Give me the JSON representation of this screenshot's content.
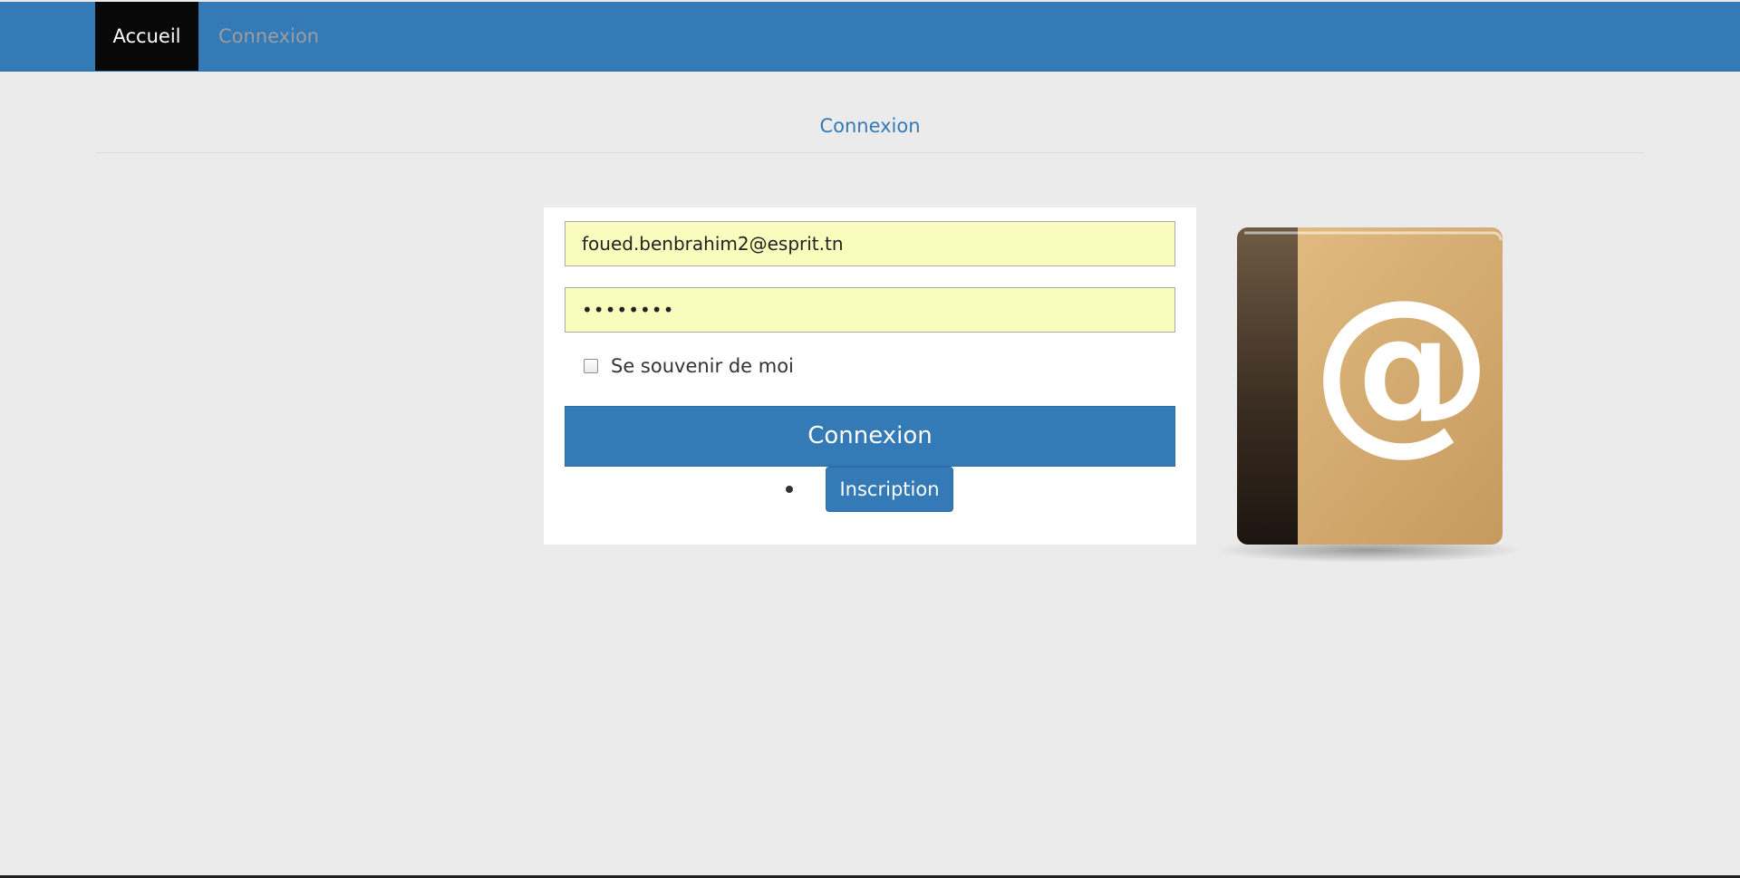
{
  "nav": {
    "home_label": "Accueil",
    "login_label": "Connexion"
  },
  "page": {
    "title": "Connexion"
  },
  "form": {
    "email_value": "foued.benbrahim2@esprit.tn",
    "password_value": "••••••••",
    "remember_label": "Se souvenir de moi",
    "remember_checked": false,
    "submit_label": "Connexion",
    "register_label": "Inscription"
  },
  "illustration": {
    "icon": "address-book-icon",
    "symbol": "@"
  },
  "colors": {
    "brand": "#337ab7",
    "input_autofill": "#fafcbd",
    "nav_active": "#080808",
    "background": "#ebebeb"
  }
}
